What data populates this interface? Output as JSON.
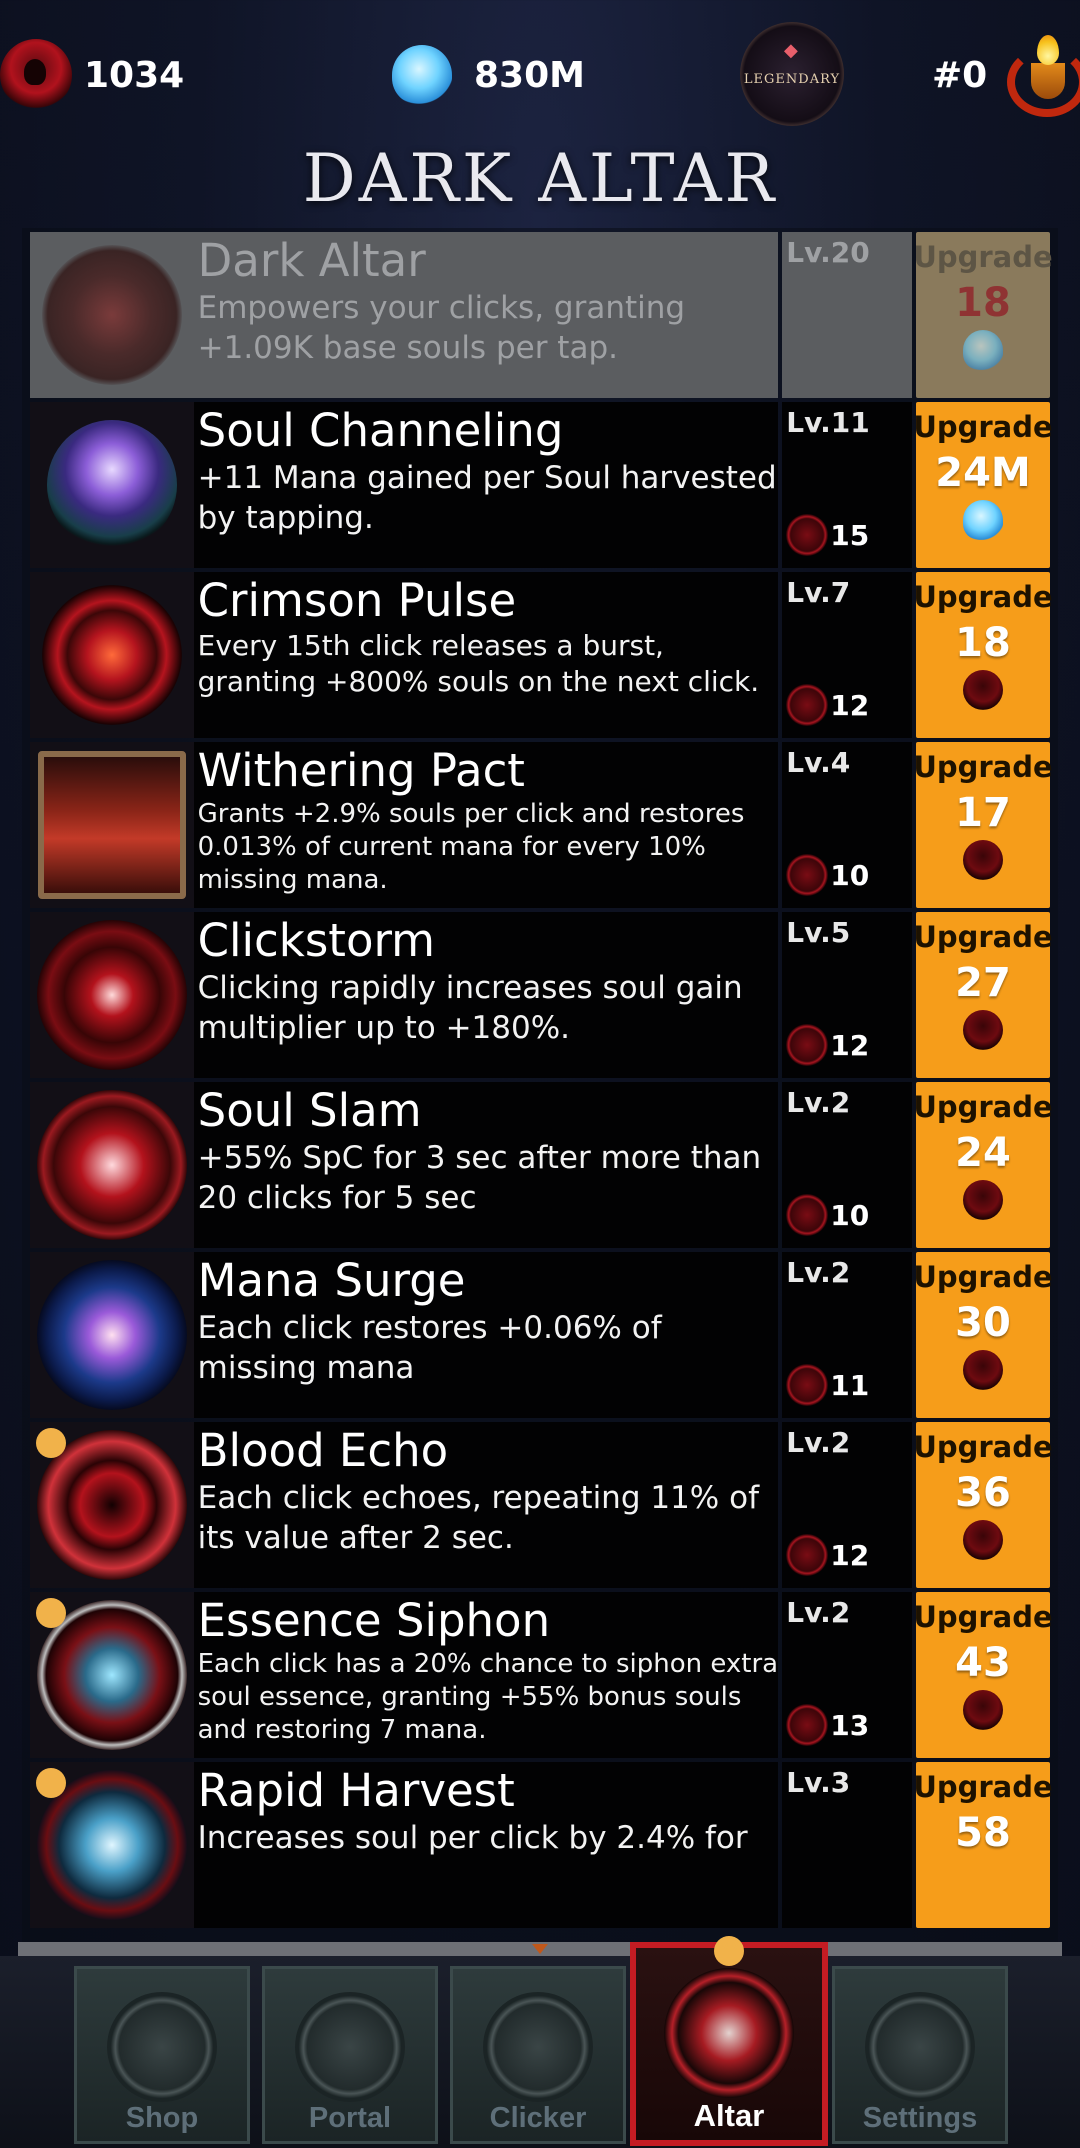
{
  "topbar": {
    "souls": "1034",
    "mana": "830M",
    "rank_badge": "LEGENDARY",
    "rank": "#0"
  },
  "title": "DARK ALTAR",
  "upgrades": [
    {
      "name": "Dark Altar",
      "desc": "Empowers your clicks, granting +1.09K base souls per tap.",
      "level": "Lv.20",
      "cost": "",
      "button": "Upgrade",
      "price": "18",
      "currency_icon": "mana-icon",
      "disabled": true
    },
    {
      "name": "Soul Channeling",
      "desc": "+11 Mana gained per Soul harvested by tapping.",
      "level": "Lv.11",
      "cost": "15",
      "button": "Upgrade",
      "price": "24M",
      "currency_icon": "mana-icon"
    },
    {
      "name": "Crimson Pulse",
      "desc": "Every 15th click releases a burst, granting +800% souls on the next click.",
      "level": "Lv.7",
      "cost": "12",
      "button": "Upgrade",
      "price": "18",
      "currency_icon": "soul-icon"
    },
    {
      "name": "Withering Pact",
      "desc": "Grants +2.9% souls per click and restores 0.013% of current mana for every 10% missing mana.",
      "level": "Lv.4",
      "cost": "10",
      "button": "Upgrade",
      "price": "17",
      "currency_icon": "soul-icon"
    },
    {
      "name": "Clickstorm",
      "desc": "Clicking rapidly increases soul gain multiplier up to +180%.",
      "level": "Lv.5",
      "cost": "12",
      "button": "Upgrade",
      "price": "27",
      "currency_icon": "soul-icon"
    },
    {
      "name": "Soul Slam",
      "desc": "+55% SpC for 3 sec after more than 20 clicks for 5 sec",
      "level": "Lv.2",
      "cost": "10",
      "button": "Upgrade",
      "price": "24",
      "currency_icon": "soul-icon"
    },
    {
      "name": "Mana Surge",
      "desc": "Each click restores +0.06% of missing mana",
      "level": "Lv.2",
      "cost": "11",
      "button": "Upgrade",
      "price": "30",
      "currency_icon": "soul-icon"
    },
    {
      "name": "Blood Echo",
      "desc": "Each click echoes, repeating 11% of its value after 2 sec.",
      "level": "Lv.2",
      "cost": "12",
      "button": "Upgrade",
      "price": "36",
      "currency_icon": "soul-icon"
    },
    {
      "name": "Essence Siphon",
      "desc": "Each click has a 20% chance to siphon extra soul essence, granting +55% bonus souls and restoring 7 mana.",
      "level": "Lv.2",
      "cost": "13",
      "button": "Upgrade",
      "price": "43",
      "currency_icon": "soul-icon"
    },
    {
      "name": "Rapid Harvest",
      "desc": "Increases soul per click by 2.4% for",
      "level": "Lv.3",
      "cost": "",
      "button": "Upgrade",
      "price": "58",
      "currency_icon": "soul-icon"
    }
  ],
  "nav": [
    {
      "label": "Shop",
      "icon": "pouch-icon"
    },
    {
      "label": "Portal",
      "icon": "portal-icon"
    },
    {
      "label": "Clicker",
      "icon": "hand-icon"
    },
    {
      "label": "Altar",
      "icon": "altar-icon",
      "active": true
    },
    {
      "label": "Settings",
      "icon": "gear-icon"
    }
  ],
  "colors": {
    "upgrade_button": "#f69d1a",
    "active_tab_border": "#c41c23",
    "notification_dot": "#f1b24a"
  }
}
